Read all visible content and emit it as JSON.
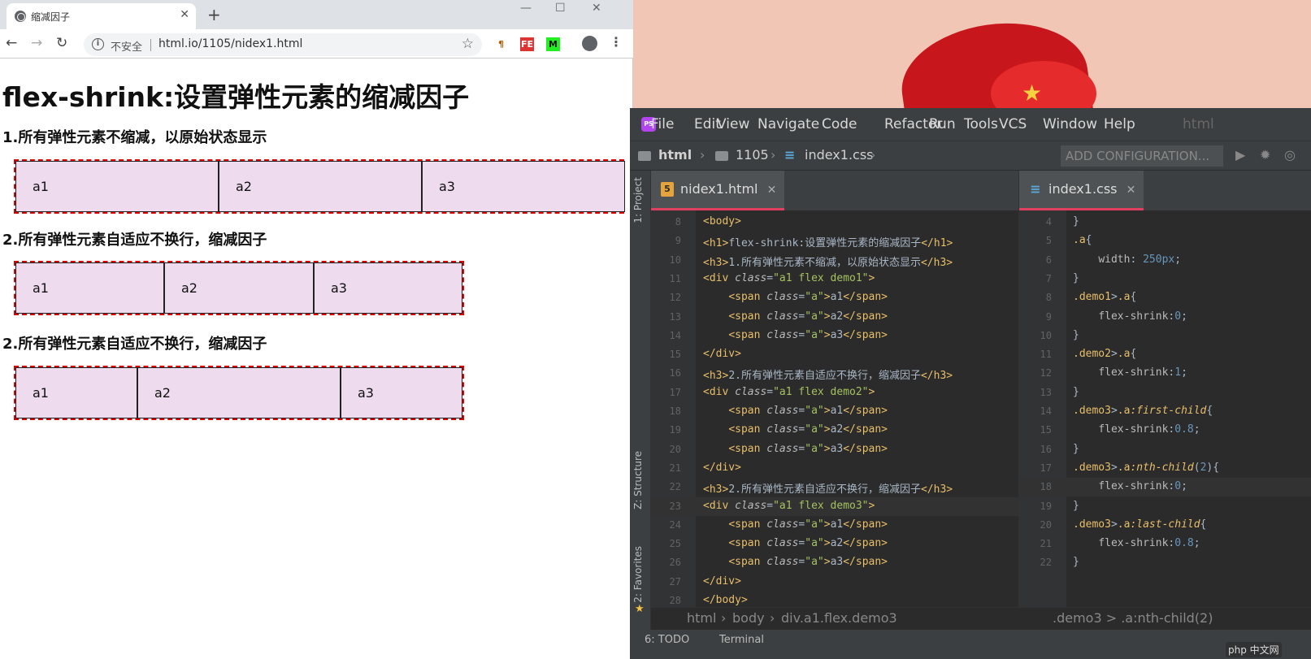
{
  "browser": {
    "tab_title": "缩减因子",
    "address": {
      "security_label": "不安全",
      "url": "html.io/1105/nidex1.html"
    },
    "ext_labels": {
      "fe": "FE",
      "m": "M"
    }
  },
  "page": {
    "h1": "flex-shrink:设置弹性元素的缩减因子",
    "sections": [
      {
        "heading": "1.所有弹性元素不缩减，以原始状态显示",
        "items": [
          "a1",
          "a2",
          "a3"
        ]
      },
      {
        "heading": "2.所有弹性元素自适应不换行，缩减因子",
        "items": [
          "a1",
          "a2",
          "a3"
        ]
      },
      {
        "heading": "2.所有弹性元素自适应不换行，缩减因子",
        "items": [
          "a1",
          "a2",
          "a3"
        ]
      }
    ]
  },
  "ide": {
    "menu": [
      "File",
      "Edit",
      "View",
      "Navigate",
      "Code",
      "Refactor",
      "Run",
      "Tools",
      "VCS",
      "Window",
      "Help"
    ],
    "menu_project": "html",
    "nav_crumbs": [
      "html",
      "1105",
      "index1.css"
    ],
    "add_config_label": "ADD CONFIGURATION...",
    "side_labels": [
      "1: Project",
      "Z: Structure",
      "2: Favorites"
    ],
    "html_tab": "nidex1.html",
    "css_tab": "index1.css",
    "bottom_left_crumbs": [
      "html",
      "body",
      "div.a1.flex.demo3"
    ],
    "bottom_right_crumb": ".demo3 > .a:nth-child(2)",
    "status": [
      "6: TODO",
      "Terminal"
    ],
    "html_start_line": 8,
    "css_start_line": 4,
    "current_html_line": 23,
    "current_css_line": 18,
    "html_code": [
      [
        [
          "t",
          "<body>"
        ]
      ],
      [
        [
          "t",
          "<h1>"
        ],
        [
          "p",
          "flex-shrink:设置弹性元素的缩减因子"
        ],
        [
          "t",
          "</h1>"
        ]
      ],
      [
        [
          "t",
          "<h3>"
        ],
        [
          "p",
          "1.所有弹性元素不缩减，以原始状态显示"
        ],
        [
          "t",
          "</h3>"
        ]
      ],
      [
        [
          "t",
          "<div "
        ],
        [
          "a",
          "class"
        ],
        [
          "p",
          "="
        ],
        [
          "s",
          "\"a1 flex demo1\""
        ],
        [
          "t",
          ">"
        ]
      ],
      [
        [
          "p",
          "    "
        ],
        [
          "t",
          "<span "
        ],
        [
          "a",
          "class"
        ],
        [
          "p",
          "="
        ],
        [
          "s",
          "\"a\""
        ],
        [
          "t",
          ">"
        ],
        [
          "p",
          "a1"
        ],
        [
          "t",
          "</span>"
        ]
      ],
      [
        [
          "p",
          "    "
        ],
        [
          "t",
          "<span "
        ],
        [
          "a",
          "class"
        ],
        [
          "p",
          "="
        ],
        [
          "s",
          "\"a\""
        ],
        [
          "t",
          ">"
        ],
        [
          "p",
          "a2"
        ],
        [
          "t",
          "</span>"
        ]
      ],
      [
        [
          "p",
          "    "
        ],
        [
          "t",
          "<span "
        ],
        [
          "a",
          "class"
        ],
        [
          "p",
          "="
        ],
        [
          "s",
          "\"a\""
        ],
        [
          "t",
          ">"
        ],
        [
          "p",
          "a3"
        ],
        [
          "t",
          "</span>"
        ]
      ],
      [
        [
          "t",
          "</div>"
        ]
      ],
      [
        [
          "t",
          "<h3>"
        ],
        [
          "p",
          "2.所有弹性元素自适应不换行，缩减因子"
        ],
        [
          "t",
          "</h3>"
        ]
      ],
      [
        [
          "t",
          "<div "
        ],
        [
          "a",
          "class"
        ],
        [
          "p",
          "="
        ],
        [
          "s",
          "\"a1 flex demo2\""
        ],
        [
          "t",
          ">"
        ]
      ],
      [
        [
          "p",
          "    "
        ],
        [
          "t",
          "<span "
        ],
        [
          "a",
          "class"
        ],
        [
          "p",
          "="
        ],
        [
          "s",
          "\"a\""
        ],
        [
          "t",
          ">"
        ],
        [
          "p",
          "a1"
        ],
        [
          "t",
          "</span>"
        ]
      ],
      [
        [
          "p",
          "    "
        ],
        [
          "t",
          "<span "
        ],
        [
          "a",
          "class"
        ],
        [
          "p",
          "="
        ],
        [
          "s",
          "\"a\""
        ],
        [
          "t",
          ">"
        ],
        [
          "p",
          "a2"
        ],
        [
          "t",
          "</span>"
        ]
      ],
      [
        [
          "p",
          "    "
        ],
        [
          "t",
          "<span "
        ],
        [
          "a",
          "class"
        ],
        [
          "p",
          "="
        ],
        [
          "s",
          "\"a\""
        ],
        [
          "t",
          ">"
        ],
        [
          "p",
          "a3"
        ],
        [
          "t",
          "</span>"
        ]
      ],
      [
        [
          "t",
          "</div>"
        ]
      ],
      [
        [
          "t",
          "<h3>"
        ],
        [
          "p",
          "2.所有弹性元素自适应不换行，缩减因子"
        ],
        [
          "t",
          "</h3>"
        ]
      ],
      [
        [
          "t",
          "<div "
        ],
        [
          "a",
          "class"
        ],
        [
          "p",
          "="
        ],
        [
          "s",
          "\"a1 flex demo3\""
        ],
        [
          "t",
          ">"
        ]
      ],
      [
        [
          "p",
          "    "
        ],
        [
          "t",
          "<span "
        ],
        [
          "a",
          "class"
        ],
        [
          "p",
          "="
        ],
        [
          "s",
          "\"a\""
        ],
        [
          "t",
          ">"
        ],
        [
          "p",
          "a1"
        ],
        [
          "t",
          "</span>"
        ]
      ],
      [
        [
          "p",
          "    "
        ],
        [
          "t",
          "<span "
        ],
        [
          "a",
          "class"
        ],
        [
          "p",
          "="
        ],
        [
          "s",
          "\"a\""
        ],
        [
          "t",
          ">"
        ],
        [
          "p",
          "a2"
        ],
        [
          "t",
          "</span>"
        ]
      ],
      [
        [
          "p",
          "    "
        ],
        [
          "t",
          "<span "
        ],
        [
          "a",
          "class"
        ],
        [
          "p",
          "="
        ],
        [
          "s",
          "\"a\""
        ],
        [
          "t",
          ">"
        ],
        [
          "p",
          "a3"
        ],
        [
          "t",
          "</span>"
        ]
      ],
      [
        [
          "t",
          "</div>"
        ]
      ],
      [
        [
          "t",
          "</body>"
        ]
      ]
    ],
    "css_code": [
      [
        [
          "p",
          "}"
        ]
      ],
      [
        [
          "sel",
          ".a"
        ],
        [
          "p",
          "{"
        ]
      ],
      [
        [
          "p",
          "    "
        ],
        [
          "prop",
          "width"
        ],
        [
          "p",
          ": "
        ],
        [
          "val",
          "250px"
        ],
        [
          "p",
          ";"
        ]
      ],
      [
        [
          "p",
          "}"
        ]
      ],
      [
        [
          "sel",
          ".demo1"
        ],
        [
          "p",
          ">"
        ],
        [
          "sel",
          ".a"
        ],
        [
          "p",
          "{"
        ]
      ],
      [
        [
          "p",
          "    "
        ],
        [
          "prop",
          "flex-shrink"
        ],
        [
          "p",
          ":"
        ],
        [
          "val",
          "0"
        ],
        [
          "p",
          ";"
        ]
      ],
      [
        [
          "p",
          "}"
        ]
      ],
      [
        [
          "sel",
          ".demo2"
        ],
        [
          "p",
          ">"
        ],
        [
          "sel",
          ".a"
        ],
        [
          "p",
          "{"
        ]
      ],
      [
        [
          "p",
          "    "
        ],
        [
          "prop",
          "flex-shrink"
        ],
        [
          "p",
          ":"
        ],
        [
          "val",
          "1"
        ],
        [
          "p",
          ";"
        ]
      ],
      [
        [
          "p",
          "}"
        ]
      ],
      [
        [
          "sel",
          ".demo3"
        ],
        [
          "p",
          ">"
        ],
        [
          "sel",
          ".a"
        ],
        [
          "pseudo",
          ":first-child"
        ],
        [
          "p",
          "{"
        ]
      ],
      [
        [
          "p",
          "    "
        ],
        [
          "prop",
          "flex-shrink"
        ],
        [
          "p",
          ":"
        ],
        [
          "val",
          "0.8"
        ],
        [
          "p",
          ";"
        ]
      ],
      [
        [
          "p",
          "}"
        ]
      ],
      [
        [
          "sel",
          ".demo3"
        ],
        [
          "p",
          ">"
        ],
        [
          "sel",
          ".a"
        ],
        [
          "pseudo",
          ":nth-child"
        ],
        [
          "p",
          "("
        ],
        [
          "val",
          "2"
        ],
        [
          "p",
          "){"
        ]
      ],
      [
        [
          "p",
          "    "
        ],
        [
          "prop",
          "flex-shrink"
        ],
        [
          "p",
          ":"
        ],
        [
          "val",
          "0"
        ],
        [
          "p",
          ";"
        ]
      ],
      [
        [
          "p",
          "}"
        ]
      ],
      [
        [
          "sel",
          ".demo3"
        ],
        [
          "p",
          ">"
        ],
        [
          "sel",
          ".a"
        ],
        [
          "pseudo",
          ":last-child"
        ],
        [
          "p",
          "{"
        ]
      ],
      [
        [
          "p",
          "    "
        ],
        [
          "prop",
          "flex-shrink"
        ],
        [
          "p",
          ":"
        ],
        [
          "val",
          "0.8"
        ],
        [
          "p",
          ";"
        ]
      ],
      [
        [
          "p",
          "}"
        ]
      ]
    ]
  },
  "watermark": "php 中文网"
}
